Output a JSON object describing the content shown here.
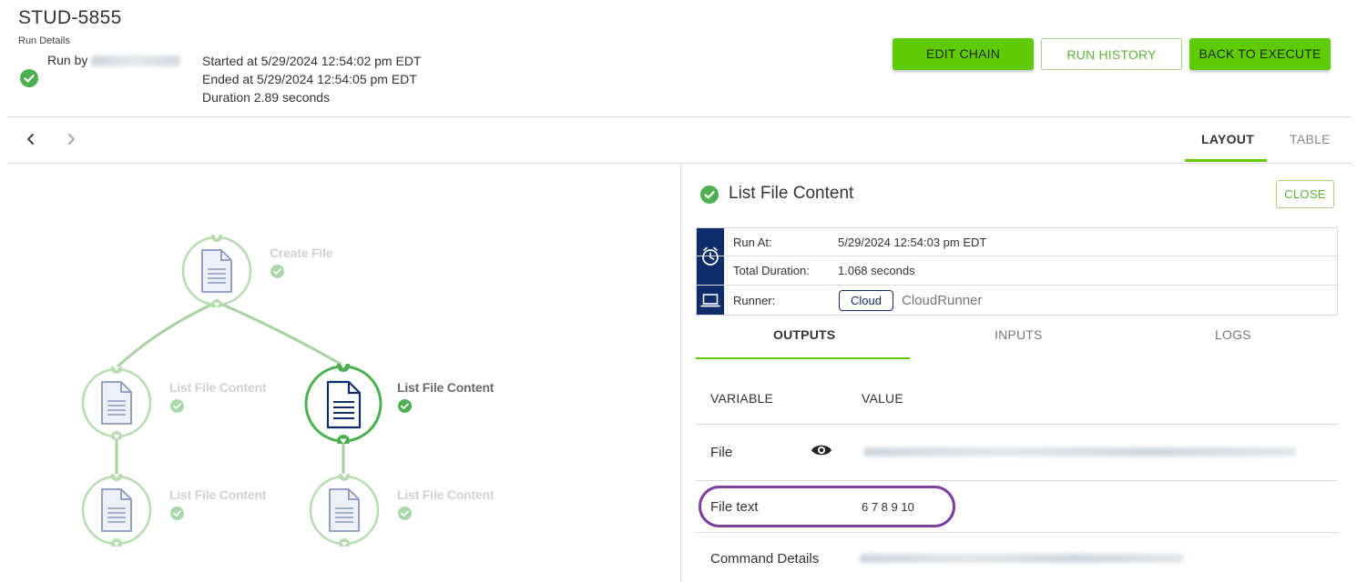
{
  "header": {
    "title": "STUD-5855",
    "subtitle": "Run Details",
    "run_by_label": "Run by",
    "started": "Started at 5/29/2024 12:54:02 pm EDT",
    "ended": "Ended at 5/29/2024 12:54:05 pm EDT",
    "duration": "Duration 2.89 seconds",
    "buttons": {
      "edit_chain": "EDIT CHAIN",
      "run_history": "RUN HISTORY",
      "back_to_execute": "BACK TO EXECUTE"
    }
  },
  "nav": {
    "prev_icon": "chevron-left-icon",
    "next_icon": "chevron-right-icon",
    "tabs": [
      "LAYOUT",
      "TABLE"
    ],
    "active_tab": "LAYOUT"
  },
  "diagram": {
    "nodes": [
      {
        "label": "Create File",
        "status": "success",
        "active": false
      },
      {
        "label": "List File Content",
        "status": "success",
        "active": false
      },
      {
        "label": "List File Content",
        "status": "success",
        "active": true
      },
      {
        "label": "List File Content",
        "status": "success",
        "active": false
      },
      {
        "label": "List File Content",
        "status": "success",
        "active": false
      }
    ]
  },
  "detail": {
    "title": "List File Content",
    "close_label": "CLOSE",
    "run_at_label": "Run At:",
    "run_at_value": "5/29/2024 12:54:03 pm EDT",
    "total_duration_label": "Total Duration:",
    "total_duration_value": "1.068 seconds",
    "runner_label": "Runner:",
    "runner_badge": "Cloud",
    "runner_name": "CloudRunner",
    "tabs": [
      "OUTPUTS",
      "INPUTS",
      "LOGS"
    ],
    "active_tab": "OUTPUTS",
    "columns": {
      "variable": "VARIABLE",
      "value": "VALUE"
    },
    "rows": [
      {
        "variable": "File",
        "value": ""
      },
      {
        "variable": "File text",
        "value": "6 7 8 9 10"
      },
      {
        "variable": "Command Details",
        "value": ""
      }
    ]
  },
  "colors": {
    "accent_green": "#5fcb05",
    "success": "#4caf50",
    "navy": "#0f2d6b",
    "highlight": "#7b3f9e"
  }
}
